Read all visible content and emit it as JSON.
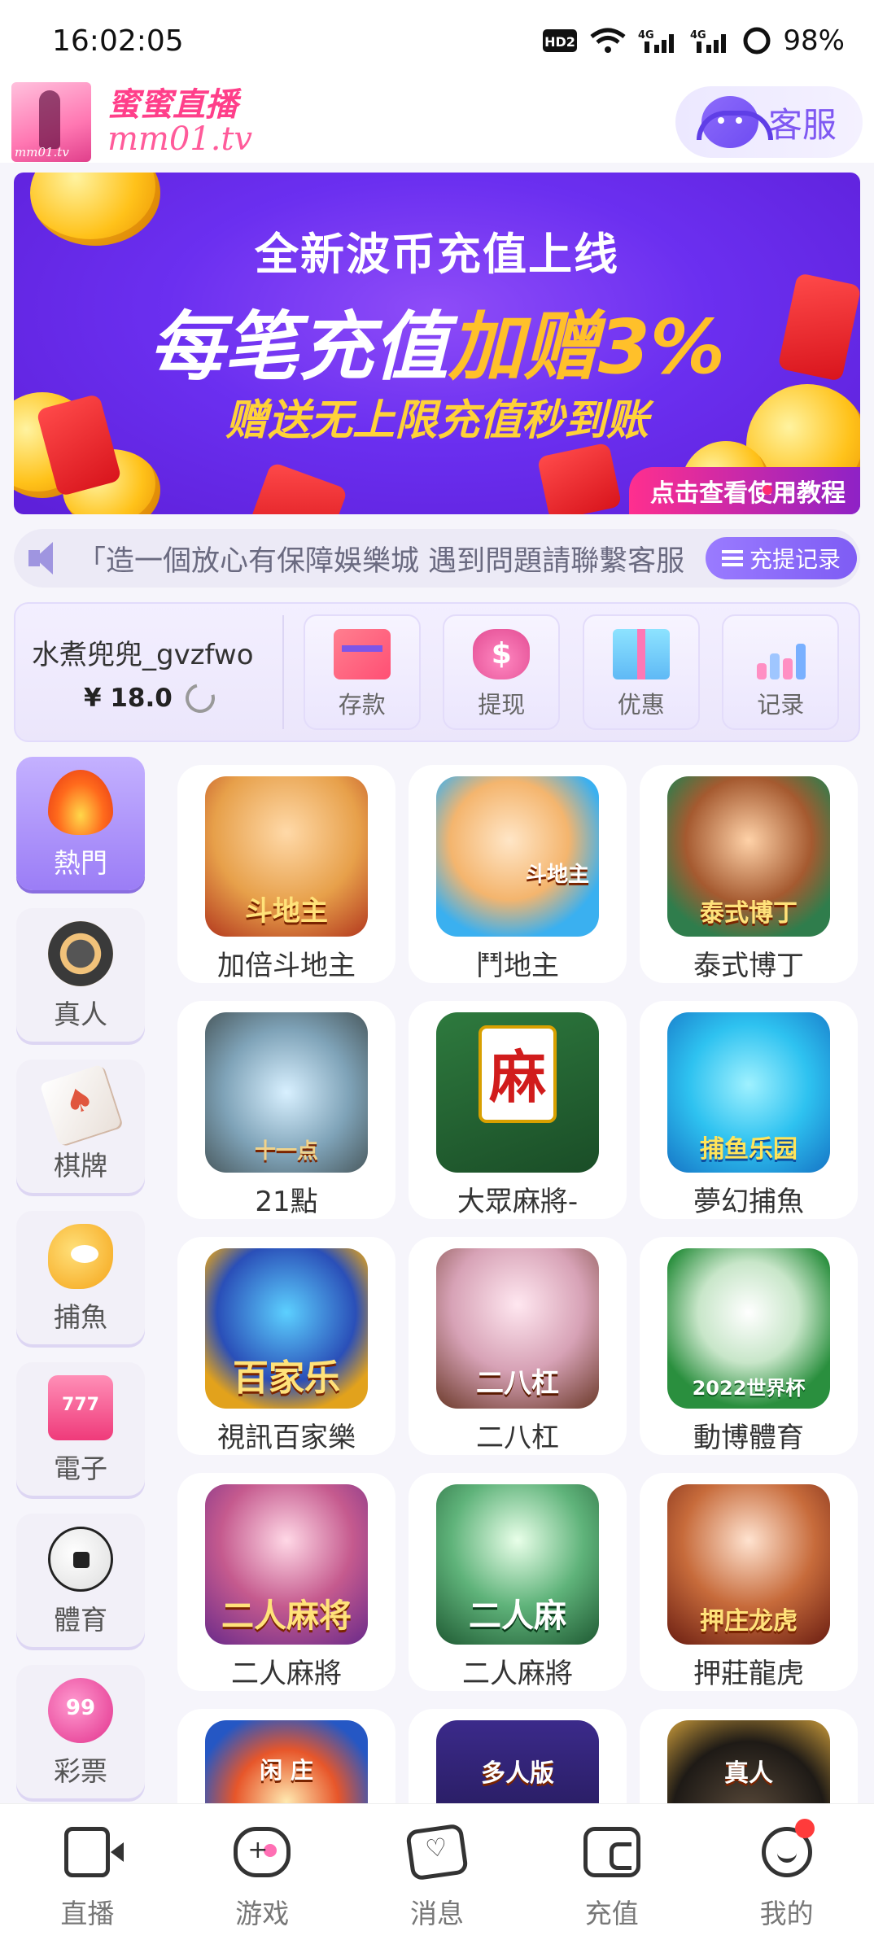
{
  "status_bar": {
    "time": "16:02:05",
    "battery": "98%",
    "hd_label": "HD2",
    "network_labels": [
      "4G",
      "4G"
    ]
  },
  "header": {
    "logo_name": "蜜蜜直播",
    "logo_domain": "mm01.tv",
    "logo_mini": "mm01.tv",
    "service_label": "客服"
  },
  "banner": {
    "line1": "全新波币充值上线",
    "line2_white": "每笔充值",
    "line2_yellow": "加赠3%",
    "line3": "赠送无上限充值秒到账",
    "cta": "点击查看使用教程"
  },
  "notice": {
    "text": "「造一個放心有保障娛樂城  遇到問題請聯繫客服",
    "record_button": "充提记录"
  },
  "user": {
    "username": "水煮兜兜_gvzfwo",
    "balance": "¥ 18.0"
  },
  "actions": [
    {
      "label": "存款",
      "icon": "card-icon"
    },
    {
      "label": "提现",
      "icon": "money-bag-icon"
    },
    {
      "label": "优惠",
      "icon": "gift-icon"
    },
    {
      "label": "记录",
      "icon": "bar-chart-icon"
    }
  ],
  "categories": [
    {
      "label": "熱門",
      "icon": "fire-icon",
      "active": true
    },
    {
      "label": "真人",
      "icon": "chip-icon",
      "active": false
    },
    {
      "label": "棋牌",
      "icon": "card-icon",
      "active": false
    },
    {
      "label": "捕魚",
      "icon": "fish-icon",
      "active": false
    },
    {
      "label": "電子",
      "icon": "slot-icon",
      "active": false
    },
    {
      "label": "體育",
      "icon": "soccer-ball-icon",
      "active": false
    },
    {
      "label": "彩票",
      "icon": "lottery-ball-icon",
      "active": false
    }
  ],
  "games": [
    {
      "name": "加倍斗地主",
      "thumb_text": "斗地主"
    },
    {
      "name": "鬥地主",
      "thumb_text": "斗地主"
    },
    {
      "name": "泰式博丁",
      "thumb_text": "泰式博丁"
    },
    {
      "name": "21點",
      "thumb_text": "十一点"
    },
    {
      "name": "大眾麻將-",
      "thumb_text": "麻"
    },
    {
      "name": "夢幻捕魚",
      "thumb_text": "捕鱼乐园"
    },
    {
      "name": "視訊百家樂",
      "thumb_text": "百家乐"
    },
    {
      "name": "二八杠",
      "thumb_text": "二八杠"
    },
    {
      "name": "動博體育",
      "thumb_text": "2022世界杯"
    },
    {
      "name": "二人麻將",
      "thumb_text": "二人麻将"
    },
    {
      "name": "二人麻將",
      "thumb_text": "二人麻"
    },
    {
      "name": "押莊龍虎",
      "thumb_text": "押庄龙虎"
    },
    {
      "name": "",
      "thumb_text": "闲 庄"
    },
    {
      "name": "",
      "thumb_text": "多人版"
    },
    {
      "name": "",
      "thumb_text": "真人"
    }
  ],
  "bottom_nav": [
    {
      "label": "直播",
      "icon": "video-camera-icon"
    },
    {
      "label": "游戏",
      "icon": "gamepad-icon"
    },
    {
      "label": "消息",
      "icon": "message-icon"
    },
    {
      "label": "充值",
      "icon": "wallet-icon"
    },
    {
      "label": "我的",
      "icon": "profile-icon",
      "badge": true
    }
  ],
  "colors": {
    "accent": "#7f58f2",
    "brand_pink": "#ff3f8a",
    "banner_purple": "#6b2ff0",
    "badge_red": "#ff3b3b"
  }
}
